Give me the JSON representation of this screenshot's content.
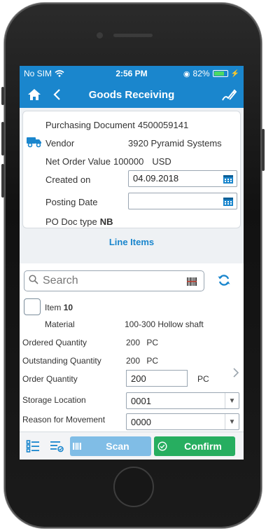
{
  "status_bar": {
    "carrier": "No SIM",
    "time": "2:56 PM",
    "battery": "82%",
    "battery_level": 0.82
  },
  "nav": {
    "title": "Goods Receiving"
  },
  "header": {
    "purchasing_document_label": "Purchasing Document",
    "purchasing_document_value": "4500059141",
    "vendor_label": "Vendor",
    "vendor_value": "3920 Pyramid Systems",
    "net_order_value_label": "Net Order Value",
    "net_order_value_value": "100000",
    "net_order_value_currency": "USD",
    "created_on_label": "Created on",
    "created_on_value": "04.09.2018",
    "posting_date_label": "Posting Date",
    "posting_date_value": "",
    "po_doc_type_label": "PO Doc type",
    "po_doc_type_value": "NB"
  },
  "line_items_label": "Line Items",
  "search": {
    "placeholder": "Search"
  },
  "item": {
    "label": "Item",
    "number": "10",
    "material_label": "Material",
    "material_value": "100-300 Hollow shaft",
    "ordered_quantity_label": "Ordered Quantity",
    "ordered_quantity_value": "200",
    "ordered_quantity_unit": "PC",
    "outstanding_quantity_label": "Outstanding Quantity",
    "outstanding_quantity_value": "200",
    "outstanding_quantity_unit": "PC",
    "order_quantity_label": "Order Quantity",
    "order_quantity_value": "200",
    "order_quantity_unit": "PC",
    "storage_location_label": "Storage Location",
    "storage_location_value": "0001",
    "reason_for_movement_label": "Reason for Movement",
    "reason_for_movement_value": "0000"
  },
  "footer": {
    "scan_label": "Scan",
    "confirm_label": "Confirm"
  },
  "colors": {
    "brand_blue": "#1a86cd",
    "confirm_green": "#27ae60",
    "scan_disabled_blue": "#80bde6"
  },
  "icons": {
    "home": "home-icon",
    "back": "back-chevron-icon",
    "edit": "signature-edit-icon",
    "truck": "truck-icon",
    "calendar": "calendar-icon",
    "search": "search-icon",
    "barcode": "barcode-icon",
    "refresh": "refresh-icon",
    "list": "list-icon",
    "filter_list": "filter-list-icon",
    "scan": "scan-icon",
    "confirm": "check-circle-icon"
  }
}
